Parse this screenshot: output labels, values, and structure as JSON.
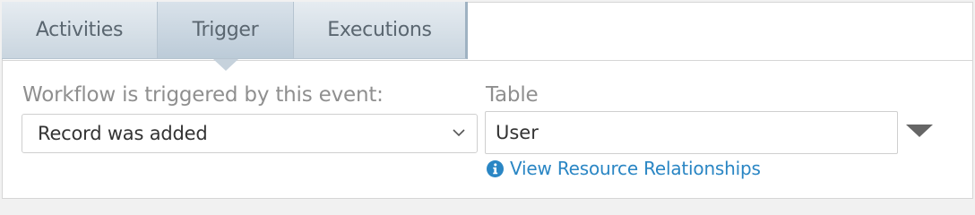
{
  "tabs": {
    "activities": "Activities",
    "trigger": "Trigger",
    "executions": "Executions"
  },
  "trigger_form": {
    "event_label": "Workflow is triggered by this event:",
    "event_value": "Record was added",
    "table_label": "Table",
    "table_value": "User",
    "relationships_link": "View Resource Relationships",
    "active_tab": "Trigger"
  },
  "icons": {
    "event_select_arrow": "chevron-down-icon",
    "table_dropdown_arrow": "triangle-down-icon",
    "link_icon": "info-icon"
  },
  "colors": {
    "tab_background": "#c9d5df",
    "tab_text": "#5a6670",
    "label_text": "#8f8f8f",
    "link": "#2a86c4"
  }
}
